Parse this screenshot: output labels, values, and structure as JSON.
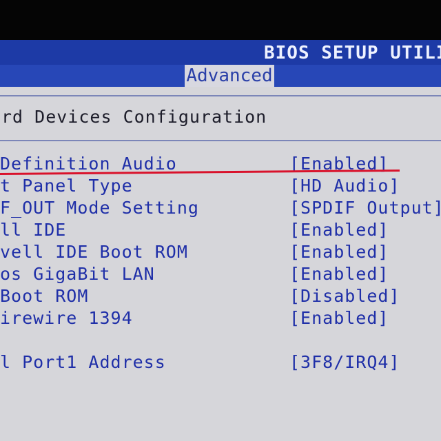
{
  "header": {
    "title": "BIOS SETUP UTILI",
    "active_tab": "Advanced"
  },
  "section": {
    "title": "rd Devices Configuration"
  },
  "settings": [
    {
      "label": "Definition Audio",
      "value": "[Enabled]"
    },
    {
      "label": "t Panel Type",
      "value": "[HD Audio]"
    },
    {
      "label": "F_OUT Mode Setting",
      "value": "[SPDIF Output]"
    },
    {
      "label": "ll IDE",
      "value": "[Enabled]"
    },
    {
      "label": "vell IDE Boot ROM",
      "value": "[Enabled]"
    },
    {
      "label": "os GigaBit LAN",
      "value": "[Enabled]"
    },
    {
      "label": " Boot ROM",
      "value": "[Disabled]"
    },
    {
      "label": "irewire 1394",
      "value": "[Enabled]"
    },
    {
      "label": "l Port1 Address",
      "value": "[3F8/IRQ4]"
    }
  ],
  "colors": {
    "title_bar": "#1d3aa6",
    "panel": "#d6d6da",
    "item_text": "#1f2fa8",
    "highlight_mark": "#d9122b"
  }
}
